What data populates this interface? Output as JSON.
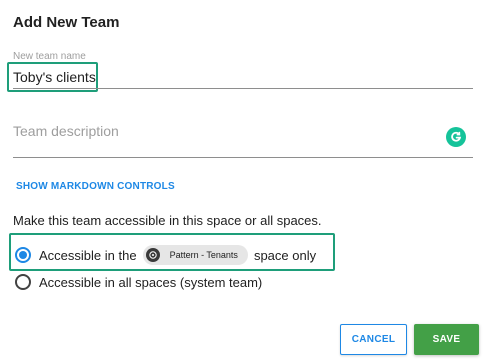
{
  "dialog": {
    "title": "Add New Team"
  },
  "name_field": {
    "label": "New team name",
    "value": "Toby's clients"
  },
  "description_field": {
    "placeholder": "Team description"
  },
  "markdown_link": "SHOW MARKDOWN CONTROLS",
  "access": {
    "heading": "Make this team accessible in this space or all spaces.",
    "option_space": {
      "prefix": "Accessible in the",
      "space_name": "Pattern - Tenants",
      "suffix": "space only",
      "selected": true
    },
    "option_all": {
      "label": "Accessible in all spaces (system team)",
      "selected": false
    }
  },
  "buttons": {
    "cancel": "CANCEL",
    "save": "SAVE"
  },
  "colors": {
    "accent": "#1e88e5",
    "save": "#43a047",
    "highlight": "#1e9e7a",
    "grammarly": "#15c39a"
  },
  "icons": {
    "grammarly": "grammarly-icon",
    "space_avatar": "space-avatar-icon"
  }
}
